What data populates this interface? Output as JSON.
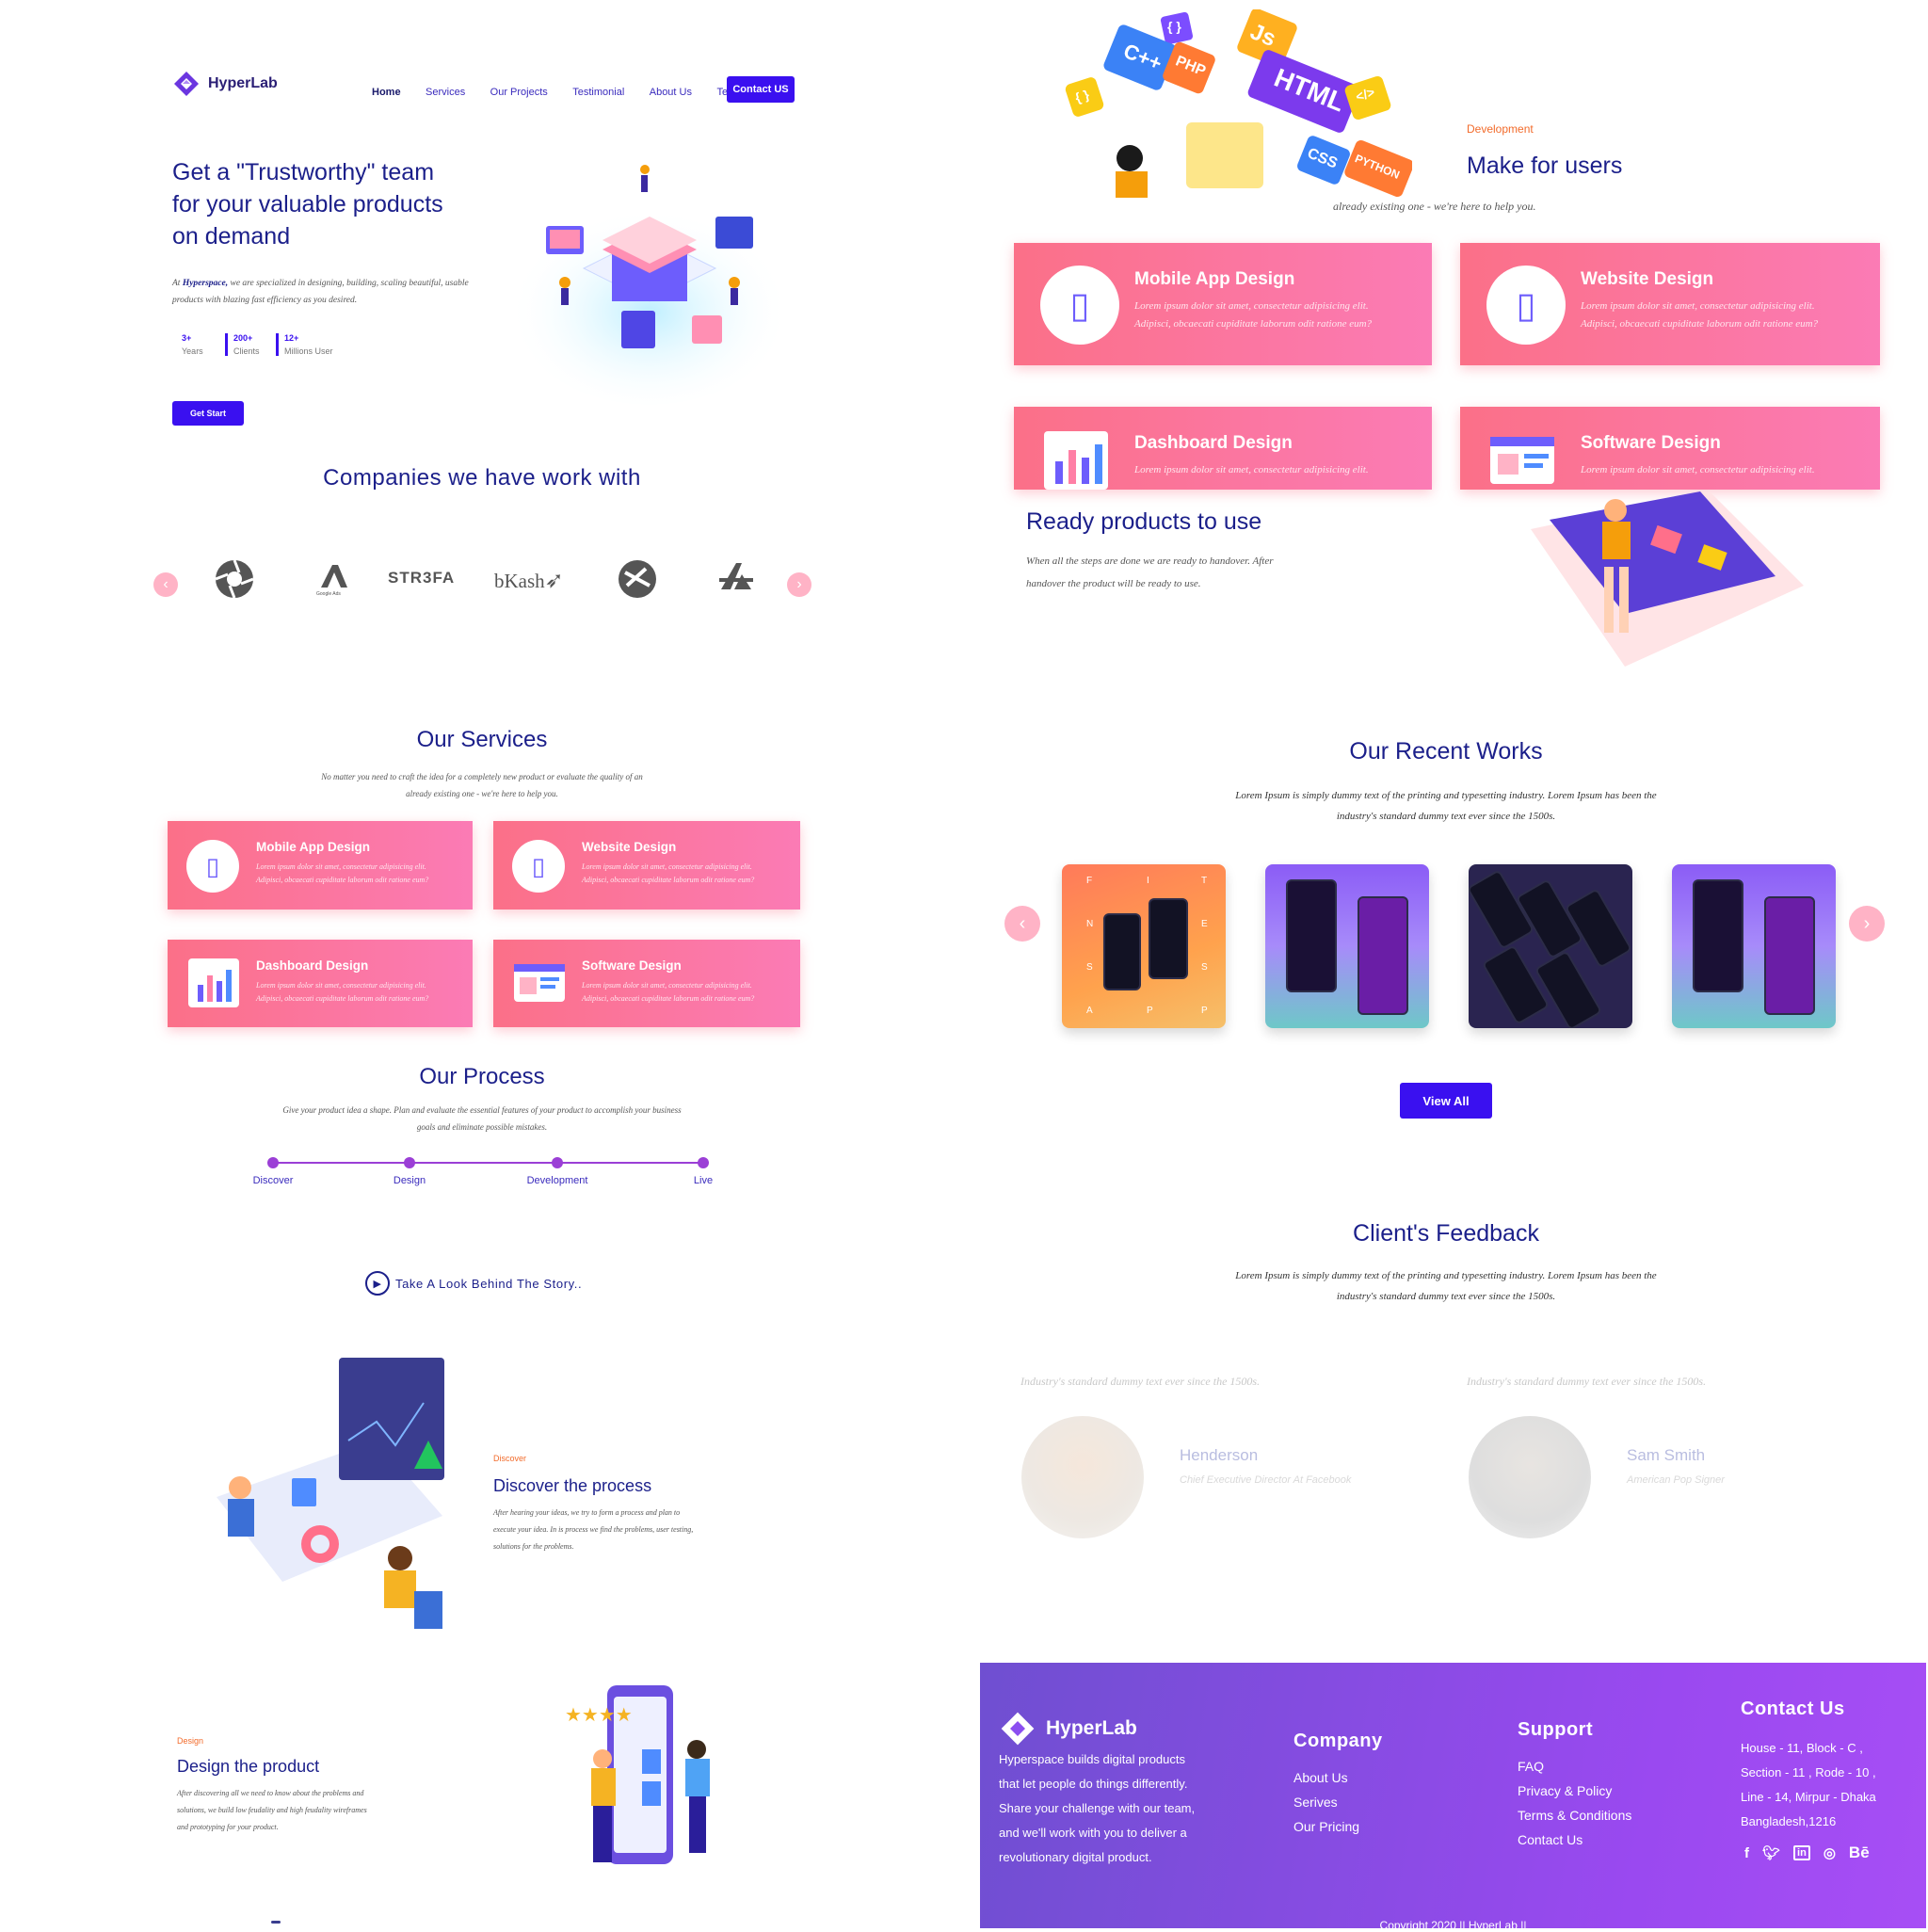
{
  "header": {
    "brand": "HyperLab",
    "nav": [
      "Home",
      "Services",
      "Our Projects",
      "Testimonial",
      "About Us",
      "Team"
    ],
    "contact_button": "Contact US"
  },
  "hero": {
    "title_line1": "Get a \"Trustworthy\" team",
    "title_line2": "for your valuable products",
    "title_line3": "on demand",
    "desc_prefix": "At ",
    "desc_brand": "Hyperspace,",
    "desc_rest": " we are specialized in designing, building, scaling beautiful, usable products with blazing fast efficiency as you desired.",
    "stats": [
      {
        "value": "3+",
        "label": "Years"
      },
      {
        "value": "200+",
        "label": "Clients"
      },
      {
        "value": "12+",
        "label": "Millions User"
      }
    ],
    "cta": "Get Start"
  },
  "companies": {
    "title": "Companies we have work with",
    "logos": [
      "aperture-logo",
      "Google Ads",
      "STR3FA",
      "bKash",
      "round-logo",
      "app-store-logo"
    ],
    "logo_texts": {
      "google": "Google Ads",
      "strefa": "STR3FA",
      "bkash": "bKash"
    }
  },
  "services": {
    "title": "Our Services",
    "subtitle_line1": "No matter you need to craft the idea for a completely new product or evaluate the quality of an",
    "subtitle_line2": "already existing one - we're here to help you.",
    "lorem1": "Lorem ipsum dolor sit amet, consectetur adipisicing elit.",
    "lorem2": "Adipisci, obcaecati cupiditate laborum odit ratione eum?",
    "items": [
      "Mobile App Design",
      "Website Design",
      "Dashboard Design",
      "Software Design"
    ]
  },
  "process": {
    "title": "Our Process",
    "subtitle_line1": "Give your product idea a shape. Plan and evaluate the essential features of your product to accomplish your business",
    "subtitle_line2": "goals and eliminate possible mistakes.",
    "steps": [
      "Discover",
      "Design",
      "Development",
      "Live"
    ],
    "video_link": "Take A Look Behind The Story.."
  },
  "discover": {
    "tag": "Discover",
    "title": "Discover the process",
    "desc_line1": "After hearing your ideas, we try to form a process and plan to",
    "desc_line2": "execute your idea. In is process we find the problems, user testing,",
    "desc_line3": "solutions for the problems."
  },
  "design": {
    "tag": "Design",
    "title": "Design the product",
    "desc_line1": "After discovering all we need to know about the problems and",
    "desc_line2": "solutions, we build low feudality and high feudality wireframes",
    "desc_line3": "and prototyping for your product."
  },
  "development": {
    "tag": "Development",
    "title": "Make for users",
    "subtitle": "already existing one - we're here to help you.",
    "code_tags": [
      "{ }",
      "C++",
      "PHP",
      "Js",
      "HTML",
      "</>",
      "CSS",
      "PYTHON",
      "{ }"
    ]
  },
  "services_large": {
    "items": [
      "Mobile App Design",
      "Website Design",
      "Dashboard Design",
      "Software Design"
    ]
  },
  "ready": {
    "title": "Ready products to use",
    "desc_line1": "When all the steps are done we are ready to handover. After",
    "desc_line2": "handover the product will be ready to use."
  },
  "works": {
    "title": "Our Recent Works",
    "desc_line1": "Lorem Ipsum is simply dummy text of the printing and typesetting industry. Lorem Ipsum has been the",
    "desc_line2": "industry's standard dummy text ever since the 1500s.",
    "fitness_letters": [
      "F",
      "I",
      "T",
      "N",
      "E",
      "S",
      "S",
      "A",
      "P",
      "P"
    ],
    "view_all": "View All"
  },
  "feedback": {
    "title": "Client's Feedback",
    "desc_line1": "Lorem Ipsum is simply dummy text of the printing and typesetting industry. Lorem Ipsum has been the",
    "desc_line2": "industry's standard dummy text ever since the 1500s.",
    "quote": "Industry's standard dummy text ever since the 1500s.",
    "clients": [
      {
        "name": "Henderson",
        "role": "Chief Executive Director At Facebook"
      },
      {
        "name": "Sam Smith",
        "role": "American Pop Signer"
      }
    ]
  },
  "footer": {
    "brand": "HyperLab",
    "about_lines": [
      "Hyperspace builds digital products",
      "that let people do things differently.",
      "Share your challenge with our team,",
      "and we'll work with you to deliver a",
      "revolutionary digital product."
    ],
    "company_title": "Company",
    "company_links": [
      "About Us",
      "Serives",
      "Our Pricing"
    ],
    "support_title": "Support",
    "support_links": [
      "FAQ",
      "Privacy & Policy",
      "Terms & Conditions",
      "Contact Us"
    ],
    "contact_title": "Contact Us",
    "address_lines": [
      "House - 11, Block - C ,",
      "Section - 11 , Rode - 10 ,",
      "Line - 14, Mirpur - Dhaka",
      "Bangladesh,1216"
    ],
    "social": [
      "f",
      "twitter",
      "in",
      "dribbble",
      "Bē"
    ],
    "copyright": "Copyright 2020 || HyperLab ||"
  },
  "colors": {
    "accent": "#3a10f0",
    "pink": "#fb7088",
    "navy": "#1b1f8a",
    "orange": "#f26b2b",
    "purple_footer": "#8b4ef0"
  }
}
